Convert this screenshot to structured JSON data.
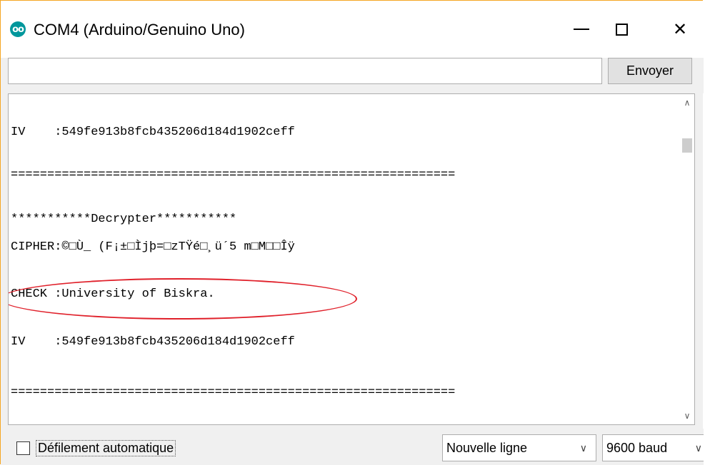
{
  "window": {
    "title": "COM4 (Arduino/Genuino Uno)",
    "icon": "arduino-icon",
    "controls": {
      "minimize": "minimize-icon",
      "maximize": "maximize-icon",
      "close": "✕"
    }
  },
  "input": {
    "value": "",
    "send_label": "Envoyer"
  },
  "console": {
    "lines": [
      "IV    :549fe913b8fcb435206d184d1902ceff",
      "=============================================================",
      "***********Decrypter***********",
      "CIPHER:©□Ù_ (F¡±□Ìjþ=□zTŸé□¸ü´5 m□M□□Îÿ",
      "CHECK :University of Biskra.",
      "IV    :549fe913b8fcb435206d184d1902ceff",
      "============================================================="
    ]
  },
  "status": {
    "autoscroll_label": "Défilement automatique",
    "autoscroll_checked": false,
    "line_ending": "Nouvelle ligne",
    "baud": "9600 baud"
  },
  "colors": {
    "highlight": "#e0202a",
    "arduino": "#00979c"
  }
}
